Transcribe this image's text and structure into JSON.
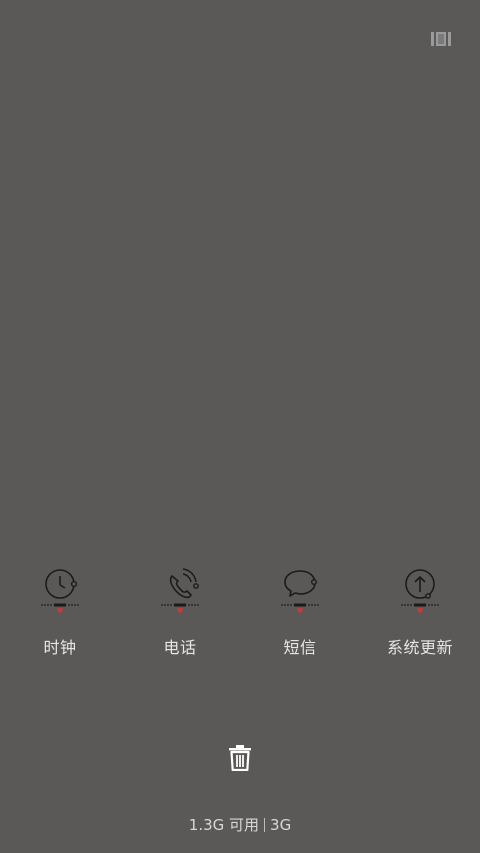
{
  "top_right": {
    "icon": "recent-apps-layout-icon"
  },
  "apps": [
    {
      "label": "时钟",
      "icon": "clock-icon"
    },
    {
      "label": "电话",
      "icon": "phone-icon"
    },
    {
      "label": "短信",
      "icon": "message-icon"
    },
    {
      "label": "系统更新",
      "icon": "system-update-icon"
    }
  ],
  "trash": {
    "icon": "trash-icon"
  },
  "memory": {
    "available": "1.3G 可用",
    "total": "3G"
  },
  "colors": {
    "background": "#5a5958",
    "icon_stroke": "#1b1b1b",
    "heart": "#c93a3a",
    "label_text": "#e6e6e6"
  }
}
